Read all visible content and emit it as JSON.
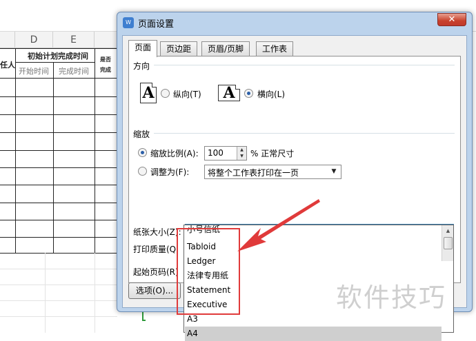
{
  "sheet": {
    "columns": [
      "D",
      "E"
    ],
    "header_left": "任人",
    "header_merged": "初始计划完成时间",
    "header_right": "是否",
    "header_right2": "完成",
    "sub_start": "开始时间",
    "sub_end": "完成时间"
  },
  "dialog": {
    "title": "页面设置",
    "title_icon": "W",
    "close": "✕",
    "tabs": [
      {
        "label": "页面"
      },
      {
        "label": "页边距"
      },
      {
        "label": "页眉/页脚"
      },
      {
        "label": "工作表"
      }
    ],
    "orientation": {
      "group": "方向",
      "portrait": "纵向(T)",
      "landscape": "横向(L)",
      "selected": "landscape"
    },
    "scaling": {
      "group": "缩放",
      "scale_label": "缩放比例(A):",
      "scale_value": "100",
      "scale_suffix": "% 正常尺寸",
      "fit_label": "调整为(F):",
      "fit_value": "将整个工作表打印在一页",
      "selected": "scale"
    },
    "paper_size_label": "纸张大小(Z):",
    "paper_size_value": "A4",
    "print_quality_label": "打印质量(Q",
    "first_page_label": "起始页码(R)",
    "options_button": "选项(O)..."
  },
  "dropdown_items": [
    {
      "label": "小号信纸"
    },
    {
      "label": "Tabloid"
    },
    {
      "label": "Ledger"
    },
    {
      "label": "法律专用纸"
    },
    {
      "label": "Statement"
    },
    {
      "label": "Executive"
    },
    {
      "label": "A3"
    },
    {
      "label": "A4"
    }
  ],
  "watermark": "软件技巧",
  "colors": {
    "annotation_red": "#e03a3a",
    "accent_blue": "#2b5fa8"
  }
}
